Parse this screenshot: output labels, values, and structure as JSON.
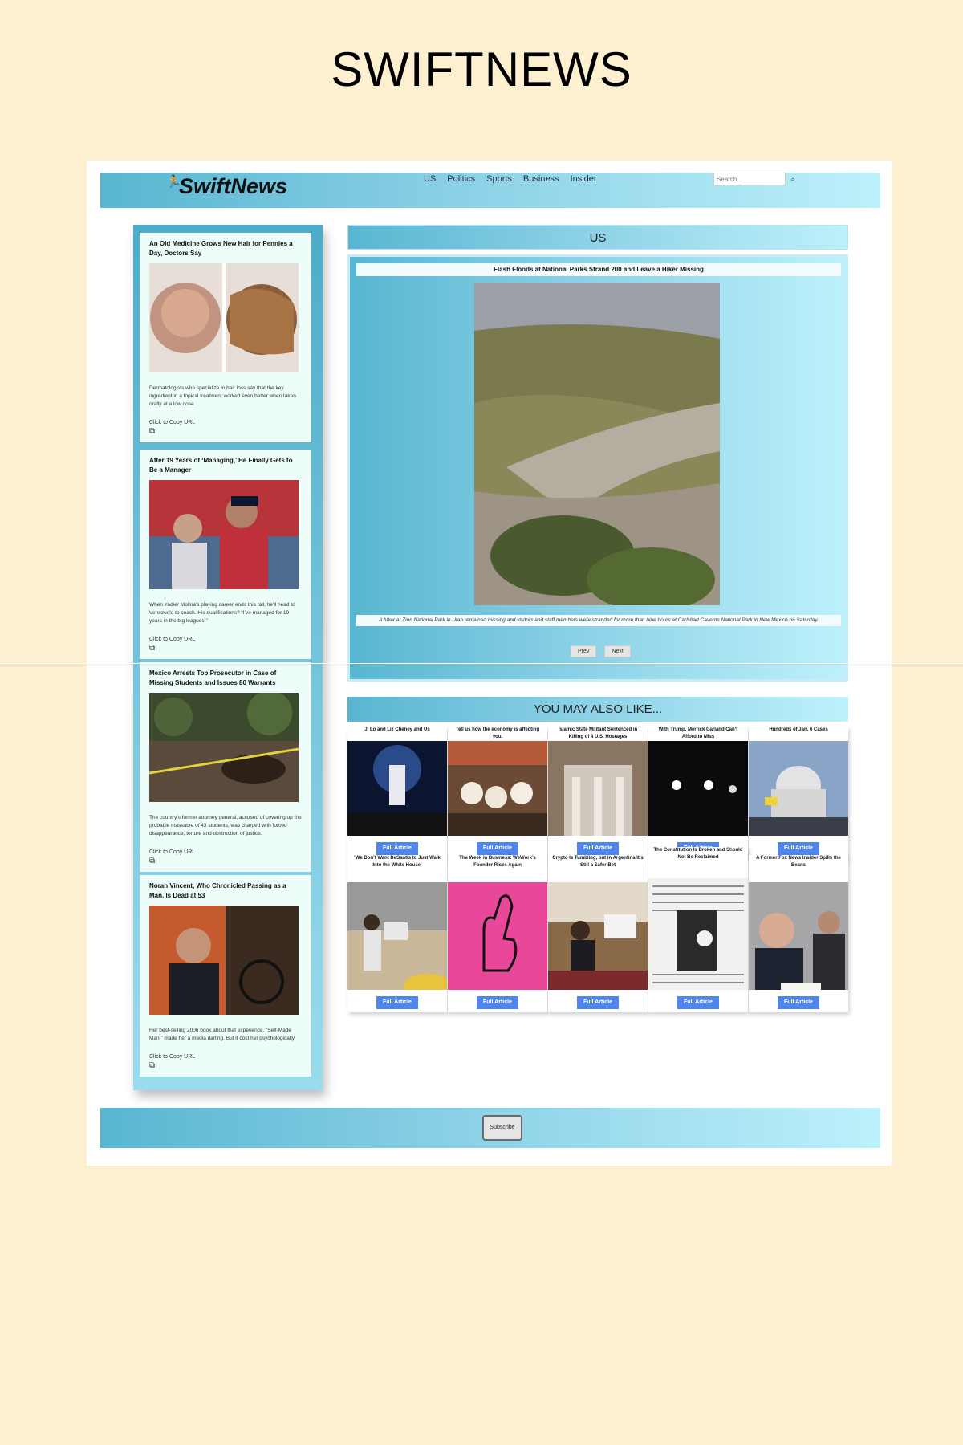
{
  "page_title": "SWIFTNEWS",
  "header": {
    "logo": "SwiftNews",
    "nav": [
      "US",
      "Politics",
      "Sports",
      "Business",
      "Insider"
    ],
    "search_placeholder": "Search..."
  },
  "sidebar": {
    "copy_label": "Click to Copy URL",
    "articles": [
      {
        "title": "An Old Medicine Grows New Hair for Pennies a Day, Doctors Say",
        "summary": "Dermatologists who specialize in hair loss say that the key ingredient in a topical treatment worked even better when taken orally at a low dose."
      },
      {
        "title": "After 19 Years of ‘Managing,’ He Finally Gets to Be a Manager",
        "summary": "When Yadier Molina’s playing career ends this fall, he’ll head to Venezuela to coach. His qualifications? “I’ve managed for 19 years in the big leagues.”"
      },
      {
        "title": "Mexico Arrests Top Prosecutor in Case of Missing Students and Issues 80 Warrants",
        "summary": "The country’s former attorney general, accused of covering up the probable massacre of 43 students, was charged with forced disappearance, torture and obstruction of justice."
      },
      {
        "title": "Norah Vincent, Who Chronicled Passing as a Man, Is Dead at 53",
        "summary": "Her best-selling 2006 book about that experience, “Self-Made Man,” made her a media darling. But it cost her psychologically."
      }
    ]
  },
  "feature": {
    "section": "US",
    "title": "Flash Floods at National Parks Strand 200 and Leave a Hiker Missing",
    "caption": "A hiker at Zion National Park in Utah remained missing and visitors and staff members were stranded for more than nine hours at Carlsbad Caverns National Park in New Mexico on Saturday.",
    "prev": "Prev",
    "next": "Next"
  },
  "related": {
    "heading": "YOU MAY ALSO LIKE...",
    "button_label": "Full Article",
    "cards": [
      {
        "title": "J. Lo and Liz Cheney and Us"
      },
      {
        "title": "Tell us how the economy is affecting you."
      },
      {
        "title": "Islamic State Militant Sentenced in Killing of 4 U.S. Hostages"
      },
      {
        "title": "With Trump, Merrick Garland Can’t Afford to Miss"
      },
      {
        "title": "Hundreds of Jan. 6 Cases"
      },
      {
        "title": "‘We Don’t Want DeSantis to Just Walk Into the White House’"
      },
      {
        "title": "The Week in Business: WeWork’s Founder Rises Again"
      },
      {
        "title": "Crypto Is Tumbling, but in Argentina It’s Still a Safer Bet"
      },
      {
        "title": "The Constitution Is Broken and Should Not Be Reclaimed"
      },
      {
        "title": "A Former Fox News Insider Spills the Beans"
      }
    ]
  },
  "footer": {
    "subscribe": "Subscribe"
  }
}
